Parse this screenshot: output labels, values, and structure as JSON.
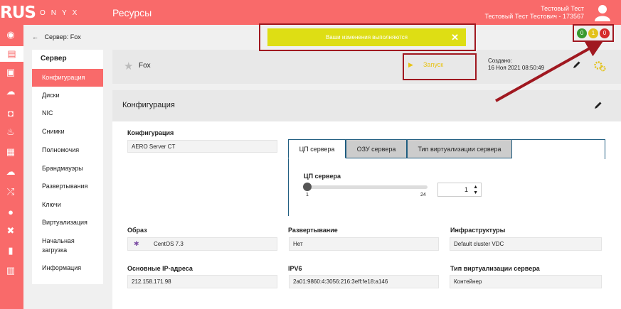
{
  "header": {
    "logo_big": "RUS",
    "logo_small": "ONYX",
    "title": "Ресурсы",
    "user_name": "Тестовый Тест",
    "user_id": "Тестовый Тест Тестович - 173567"
  },
  "breadcrumb": {
    "back": "←",
    "text": "Сервер: Fox"
  },
  "notification": {
    "text": "Ваши изменения выполняются",
    "close": "✕"
  },
  "status_counts": [
    {
      "value": "0",
      "color": "#3a9a2f"
    },
    {
      "value": "1",
      "color": "#e3c21a"
    },
    {
      "value": "0",
      "color": "#d52a2a"
    }
  ],
  "sidebar": {
    "heading": "Сервер",
    "items": [
      "Конфигурация",
      "Диски",
      "NIC",
      "Снимки",
      "Полномочия",
      "Брандмауэры",
      "Развертывания",
      "Ключи",
      "Виртуализация",
      "Начальная",
      "загрузка",
      "Информация"
    ],
    "active_index": 0
  },
  "server": {
    "name": "Fox",
    "run_label": "Запуск",
    "created_label": "Создано:",
    "created_value": "16 Ноя 2021 08:50:49"
  },
  "config": {
    "panel_title": "Конфигурация",
    "config_label": "Конфигурация",
    "config_value": "AERO Server CT",
    "tabs": [
      "ЦП сервера",
      "ОЗУ сервера",
      "Тип виртуализации сервера"
    ],
    "cpu_label": "ЦП сервера",
    "slider_min": "1",
    "slider_max": "24",
    "cpu_value": "1",
    "image_label": "Образ",
    "image_value": "CentOS 7.3",
    "deploy_label": "Развертывание",
    "deploy_value": "Нет",
    "infra_label": "Инфраструктуры",
    "infra_value": "Default cluster VDC",
    "ip_label": "Основные IP-адреса",
    "ip_value": "212.158.171.98",
    "ipv6_label": "IPV6",
    "ipv6_value": "2a01:9860:4:3056:216:3eff:fe18:a146",
    "virt_label": "Тип виртуализации сервера",
    "virt_value": "Контейнер"
  },
  "colors": {
    "brand": "#f96a6a",
    "warn": "#dede14",
    "highlight": "#a01820"
  },
  "nav_icons": [
    "dashboard-icon",
    "server-icon",
    "document-icon",
    "cloud-upload-icon",
    "camera-icon",
    "fire-icon",
    "image-icon",
    "cloud-icon",
    "shuffle-icon",
    "user-icon",
    "tools-icon",
    "clipboard-icon",
    "chart-icon"
  ]
}
